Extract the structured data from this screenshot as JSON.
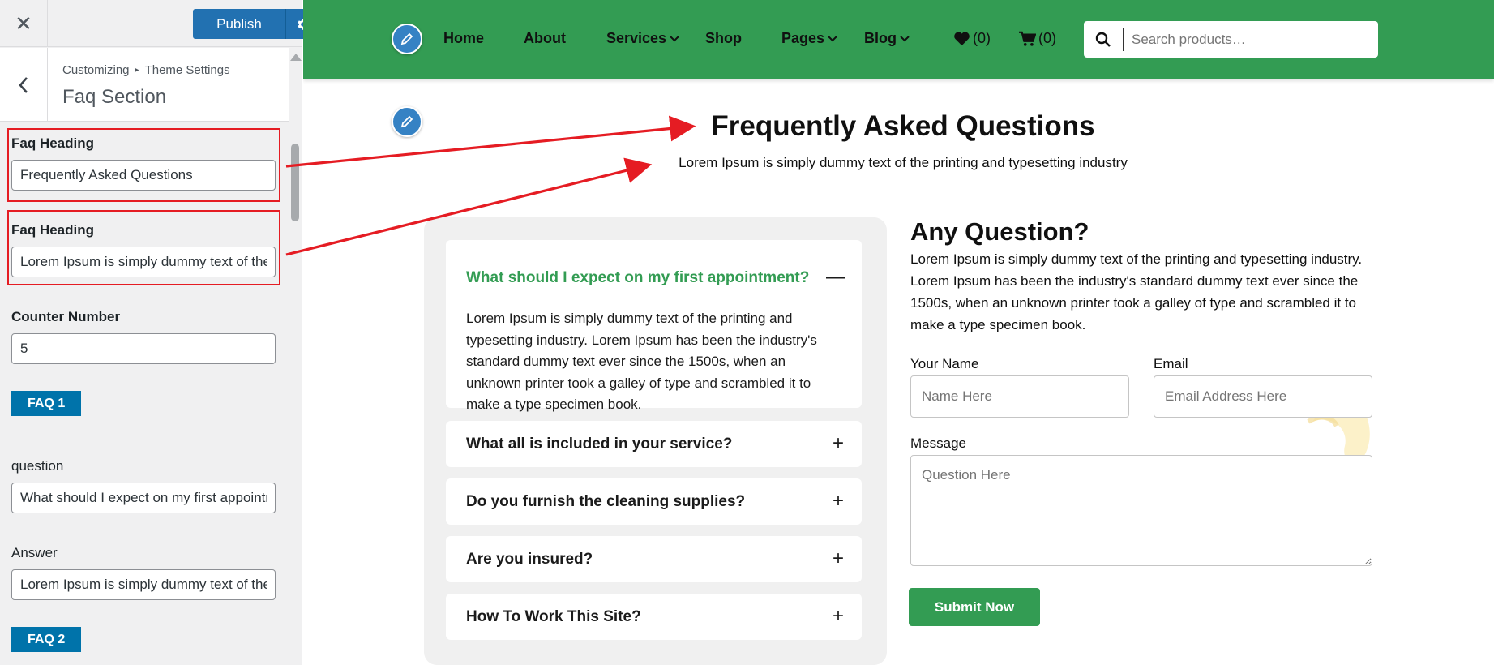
{
  "customizer": {
    "close_symbol": "✕",
    "publish_label": "Publish",
    "back_symbol": "‹",
    "breadcrumb_root": "Customizing",
    "breadcrumb_sep": "▸",
    "breadcrumb_parent": "Theme Settings",
    "section_title": "Faq Section",
    "controls": {
      "heading_label": "Faq Heading",
      "heading_value": "Frequently Asked Questions",
      "subheading_label": "Faq Heading",
      "subheading_value": "Lorem Ipsum is simply dummy text of the printing and typesetting industry",
      "counter_label": "Counter Number",
      "counter_value": "5",
      "faq1_tag": "FAQ 1",
      "question_label": "question",
      "question_value": "What should I expect on my first appointment?",
      "answer_label": "Answer",
      "answer_value": "Lorem Ipsum is simply dummy text of the printing and typesetting industry.",
      "faq2_tag": "FAQ 2"
    }
  },
  "nav": {
    "items": [
      "Home",
      "About",
      "Services",
      "Shop",
      "Pages",
      "Blog"
    ],
    "wishlist_count": "(0)",
    "cart_count": "(0)",
    "search_placeholder": "Search products…"
  },
  "faq": {
    "title": "Frequently Asked Questions",
    "subtitle": "Lorem Ipsum is simply dummy text of the printing and typesetting industry",
    "items": [
      {
        "question": "What should I expect on my first appointment?",
        "answer": "Lorem Ipsum is simply dummy text of the printing and typesetting industry. Lorem Ipsum has been the industry's standard dummy text ever since the 1500s, when an unknown printer took a galley of type and scrambled it to make a type specimen book.",
        "open": true,
        "sign": "—"
      },
      {
        "question": "What all is included in your service?",
        "sign": "+"
      },
      {
        "question": "Do you furnish the cleaning supplies?",
        "sign": "+"
      },
      {
        "question": "Are you insured?",
        "sign": "+"
      },
      {
        "question": "How To Work This Site?",
        "sign": "+"
      }
    ]
  },
  "contact": {
    "title": "Any Question?",
    "text": "Lorem Ipsum is simply dummy text of the printing and typesetting industry. Lorem Ipsum has been the industry's standard dummy text ever since the 1500s, when an unknown printer took a galley of type and scrambled it to make a type specimen book.",
    "name_label": "Your Name",
    "name_placeholder": "Name Here",
    "email_label": "Email",
    "email_placeholder": "Email Address Here",
    "message_label": "Message",
    "message_placeholder": "Question Here",
    "submit_label": "Submit Now"
  },
  "colors": {
    "brand_green": "#339c53",
    "wp_blue": "#2271b1",
    "highlight_red": "#e51c23"
  }
}
